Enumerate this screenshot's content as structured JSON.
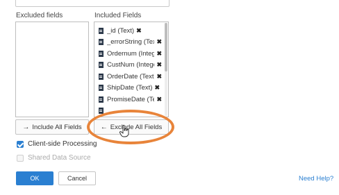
{
  "panels": {
    "excluded_label": "Excluded fields",
    "included_label": "Included Fields"
  },
  "included_fields": [
    {
      "label": "_id (Text)",
      "remove": "✖"
    },
    {
      "label": "_errorString (Text)",
      "remove": "✖"
    },
    {
      "label": "Ordernum (Integer)",
      "remove": "✖"
    },
    {
      "label": "CustNum (Integer)",
      "remove": "✖"
    },
    {
      "label": "OrderDate (Text)",
      "remove": "✖"
    },
    {
      "label": "ShipDate (Text)",
      "remove": "✖"
    },
    {
      "label": "PromiseDate (Text)",
      "remove": "✖"
    }
  ],
  "buttons": {
    "include_all": "Include All Fields",
    "include_all_arrow": "→",
    "exclude_all": "Exclude All Fields",
    "exclude_all_arrow": "←",
    "ok": "OK",
    "cancel": "Cancel"
  },
  "options": {
    "client_side": {
      "label": "Client-side Processing",
      "checked": true
    },
    "shared_source": {
      "label": "Shared Data Source",
      "checked": false,
      "disabled": true
    }
  },
  "help_link": "Need Help?",
  "colors": {
    "accent": "#2a7fd1",
    "highlight_ring": "#e8843a"
  },
  "icons": {
    "field": "document-icon",
    "remove": "close-icon"
  }
}
